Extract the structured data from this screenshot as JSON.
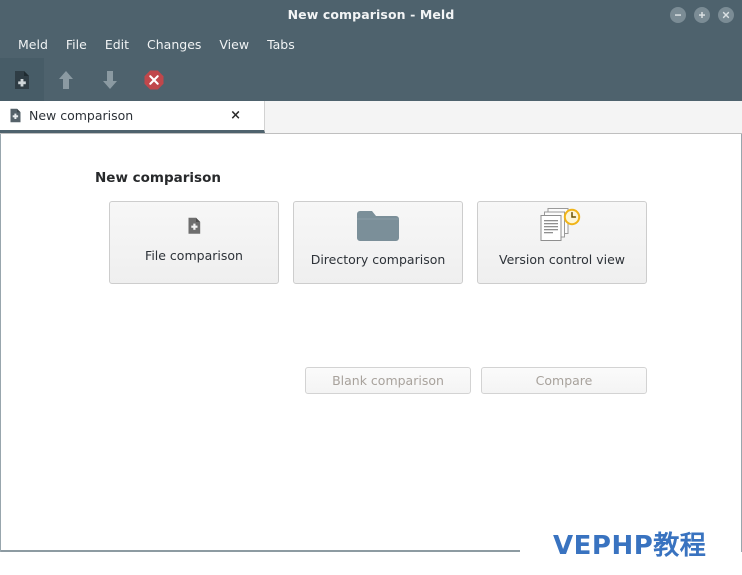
{
  "window": {
    "title": "New comparison - Meld",
    "controls": [
      {
        "name": "minimize",
        "glyph": "minus"
      },
      {
        "name": "maximize",
        "glyph": "plus"
      },
      {
        "name": "close",
        "glyph": "cross"
      }
    ]
  },
  "menubar": {
    "items": [
      {
        "label": "Meld"
      },
      {
        "label": "File"
      },
      {
        "label": "Edit"
      },
      {
        "label": "Changes"
      },
      {
        "label": "View"
      },
      {
        "label": "Tabs"
      }
    ]
  },
  "toolbar": {
    "buttons": [
      {
        "name": "new-comparison",
        "icon": "new-document-icon",
        "active": true,
        "enabled": true
      },
      {
        "name": "go-up",
        "icon": "arrow-up-icon",
        "active": false,
        "enabled": false
      },
      {
        "name": "go-down",
        "icon": "arrow-down-icon",
        "active": false,
        "enabled": false
      },
      {
        "name": "stop",
        "icon": "stop-icon",
        "active": false,
        "enabled": true
      }
    ]
  },
  "tabs": [
    {
      "label": "New comparison",
      "icon": "new-document-icon",
      "close_label": "×",
      "active": true
    }
  ],
  "main": {
    "heading": "New comparison",
    "cards": [
      {
        "label": "File comparison",
        "icon": "new-document-icon"
      },
      {
        "label": "Directory comparison",
        "icon": "folder-icon"
      },
      {
        "label": "Version control view",
        "icon": "version-control-icon"
      }
    ],
    "actions": [
      {
        "label": "Blank comparison",
        "enabled": false
      },
      {
        "label": "Compare",
        "enabled": false
      }
    ]
  },
  "watermark": {
    "text": "VEPHP教程",
    "color": "#3973c0"
  },
  "colors": {
    "titlebar_bg": "#4e626d",
    "toolbar_bg": "#4e626d",
    "tabstrip_bg": "#f4f4f4",
    "content_bg": "#ffffff",
    "card_bg": "#f2f2f2",
    "disabled_text": "#a8a29c",
    "stop_red": "#c0474b",
    "folder_grey": "#7b8f99",
    "clock_yellow": "#f5c433"
  }
}
